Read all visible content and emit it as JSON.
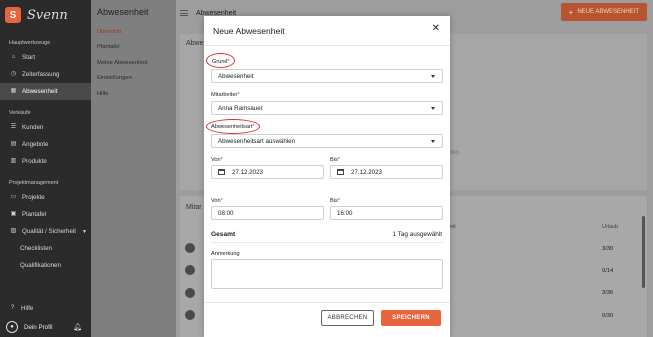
{
  "app": {
    "brand_letter": "S",
    "brand_name": "Svenn"
  },
  "sidebar": {
    "section_main": "Hauptwerkzeuge",
    "main_items": [
      {
        "label": "Start",
        "icon": "home-icon"
      },
      {
        "label": "Zeiterfassung",
        "icon": "clock-icon"
      },
      {
        "label": "Abwesenheit",
        "icon": "calendar-icon",
        "active": true
      }
    ],
    "section_sales": "Verkäufe",
    "sales_items": [
      {
        "label": "Kunden",
        "icon": "customers-icon"
      },
      {
        "label": "Angebote",
        "icon": "offers-icon"
      },
      {
        "label": "Produkte",
        "icon": "products-icon"
      }
    ],
    "section_pm": "Projektmanagement",
    "pm_items": [
      {
        "label": "Projekte",
        "icon": "projects-icon"
      },
      {
        "label": "Plantafel",
        "icon": "planboard-icon"
      },
      {
        "label": "Qualität / Sicherheit",
        "icon": "quality-icon"
      }
    ],
    "pm_sub_items": [
      "Checklisten",
      "Qualifikationen"
    ],
    "help_label": "Hilfe",
    "profile_label": "Dein Profil"
  },
  "subnav": {
    "title": "Abwesenheit",
    "items": [
      "Übersicht",
      "Plantafel",
      "Meine Abwesenheit",
      "Einstellungen",
      "Hilfe"
    ],
    "active_index": 0
  },
  "topbar": {
    "title": "Abwesenheit",
    "new_button": "NEUE ABWESENHEIT"
  },
  "background": {
    "card_title": "Abwe",
    "ghost_text": "nden",
    "list_title": "Mitar",
    "col_header_mid": "eit",
    "col_header_right": "Urlaub",
    "row_values": [
      "3/30",
      "0/14",
      "3/36",
      "0/30"
    ]
  },
  "modal": {
    "title": "Neue Abwesenheit",
    "grund_label": "Grund",
    "grund_value": "Abwesenheit",
    "mitarbeiter_label": "Mitarbeiter",
    "mitarbeiter_value": "Anna Ramsauer",
    "art_label": "Abwesenheitsart",
    "art_value": "Abwesenheitsart auswählen",
    "von_date_label": "Von",
    "von_date_value": "27.12.2023",
    "bis_date_label": "Bis",
    "bis_date_value": "27.12.2023",
    "von_time_label": "Von",
    "von_time_value": "08:00",
    "bis_time_label": "Bis",
    "bis_time_value": "16:00",
    "total_label": "Gesamt",
    "total_value": "1 Tag ausgewählt",
    "note_label": "Anmerkung",
    "cancel_label": "ABBRECHEN",
    "save_label": "SPEICHERN",
    "required_mark": "*"
  },
  "colors": {
    "accent": "#e8643c",
    "highlight": "#d0342c",
    "sidebar": "#2b2b2b"
  }
}
